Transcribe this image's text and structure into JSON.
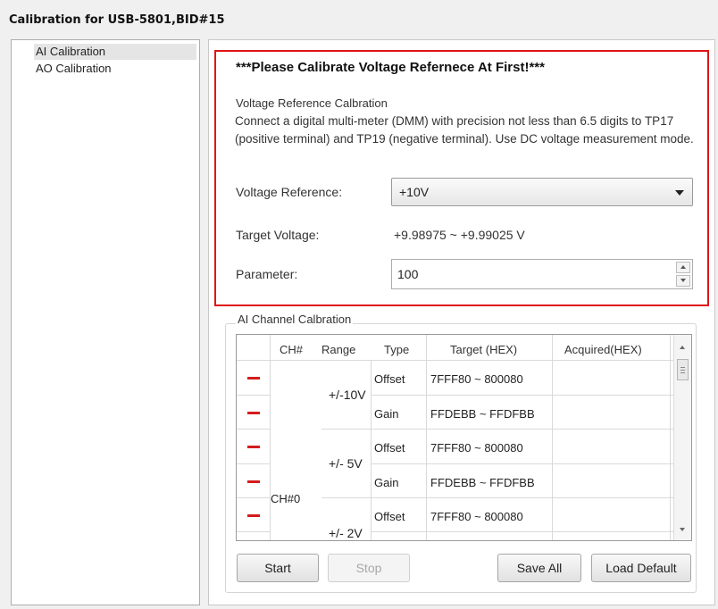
{
  "window": {
    "title": "Calibration for USB-5801,BID#15"
  },
  "sidebar": {
    "items": [
      {
        "label": "AI Calibration",
        "selected": true
      },
      {
        "label": "AO Calibration",
        "selected": false
      }
    ]
  },
  "voltage_ref": {
    "warning": "***Please Calibrate Voltage Refernece At First!***",
    "group_label": "Voltage Reference Calbration",
    "description": "Connect a digital multi-meter (DMM) with precision not less than 6.5 digits to TP17 (positive terminal) and TP19 (negative terminal). Use DC voltage measurement mode.",
    "voltage_reference_label": "Voltage Reference:",
    "voltage_reference_value": "+10V",
    "target_voltage_label": "Target Voltage:",
    "target_voltage_value": "+9.98975 ~ +9.99025 V",
    "parameter_label": "Parameter:",
    "parameter_value": "100"
  },
  "channel": {
    "group_label": "AI Channel Calbration",
    "columns": [
      "CH#",
      "Range",
      "Type",
      "Target (HEX)",
      "Acquired(HEX)"
    ],
    "channel": "CH#0",
    "ranges": [
      "+/-10V",
      "+/- 5V",
      "+/- 2V"
    ],
    "rows": [
      {
        "type": "Offset",
        "target": "7FFF80 ~ 800080",
        "acquired": ""
      },
      {
        "type": "Gain",
        "target": "FFDEBB ~ FFDFBB",
        "acquired": ""
      },
      {
        "type": "Offset",
        "target": "7FFF80 ~ 800080",
        "acquired": ""
      },
      {
        "type": "Gain",
        "target": "FFDEBB ~ FFDFBB",
        "acquired": ""
      },
      {
        "type": "Offset",
        "target": "7FFF80 ~ 800080",
        "acquired": ""
      }
    ]
  },
  "buttons": {
    "start": "Start",
    "stop": "Stop",
    "save_all": "Save All",
    "load_default": "Load Default"
  },
  "colors": {
    "highlight_border": "#e01414",
    "remove_icon": "#d31d1d"
  }
}
